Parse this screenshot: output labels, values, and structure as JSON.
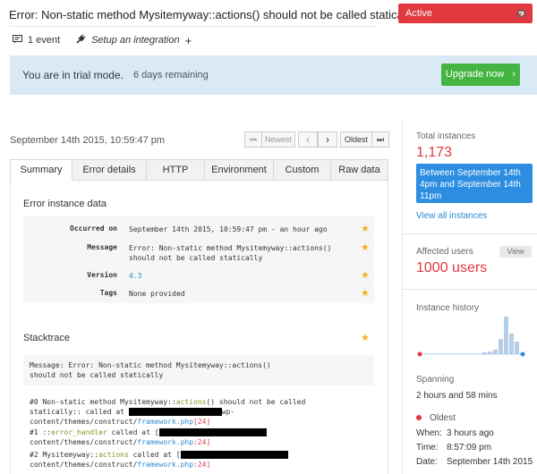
{
  "header": {
    "title": "Error: Non-static method Mysitemyway::actions() should not be called statically",
    "status": "Active",
    "events": "1 event",
    "integration": "Setup an integration",
    "plus": "+"
  },
  "trial": {
    "message": "You are in trial mode.",
    "remaining": "6 days remaining",
    "upgrade": "Upgrade now"
  },
  "instance": {
    "date": "September 14th 2015, 10:59:47 pm",
    "pager": {
      "first": "⏮",
      "newest": "Newest",
      "prev": "‹",
      "next": "›",
      "oldest": "Oldest",
      "last": "⏭"
    }
  },
  "tabs": [
    "Summary",
    "Error details",
    "HTTP",
    "Environment",
    "Custom",
    "Raw data"
  ],
  "error_instance": {
    "heading": "Error instance data",
    "rows": [
      {
        "key": "Occurred on",
        "value": "September 14th 2015, 10:59:47 pm - an hour ago"
      },
      {
        "key": "Message",
        "value": "Error: Non-static method Mysitemyway::actions() should not be called statically"
      },
      {
        "key": "Version",
        "value": "4.3"
      },
      {
        "key": "Tags",
        "value": "None provided"
      }
    ]
  },
  "stacktrace": {
    "heading": "Stacktrace",
    "message": "Message: Error: Non-static method Mysitemyway::actions() should not be called statically",
    "frames": [
      {
        "prefix": "#0 Non-static method Mysitemyway::",
        "fn": "actions",
        "mid": "() should not be called statically:: called at ",
        "tail": "wp-content/themes/construct/",
        "file": "framework.php",
        "line": "[24]"
      },
      {
        "prefix": "#1 ::",
        "fn": "error_handler",
        "mid": " called at [",
        "tail": "content/themes/construct/",
        "file": "framework.php",
        "line": ":24]"
      },
      {
        "prefix": "#2 Mysitemyway::",
        "fn": "actions",
        "mid": " called at [",
        "tail": "content/themes/construct/",
        "file": "framework.php",
        "line": ":24]"
      }
    ]
  },
  "sidebar": {
    "total_label": "Total instances",
    "total_value": "1,173",
    "between": "Between September 14th 4pm and September 14th 11pm",
    "view_all": "View all instances",
    "affected_label": "Affected users",
    "view_btn": "View",
    "affected_value": "1000 users",
    "history_label": "Instance history",
    "history_values": [
      2,
      3,
      5,
      17,
      42,
      23,
      14
    ],
    "spanning_label": "Spanning",
    "spanning_value": "2 hours and 58 mins",
    "oldest_label": "Oldest",
    "when_label": "When:",
    "when_value": "3 hours ago",
    "time_label": "Time:",
    "time_value": "8:57:09 pm",
    "date_label": "Date:",
    "date_value": "September 14th 2015"
  },
  "colors": {
    "accent_red": "#e0393f",
    "upgrade_green": "#44b543",
    "link_blue": "#2a8bd1",
    "highlight_blue": "#2d8de1",
    "banner_bg": "#d9eaf6"
  }
}
